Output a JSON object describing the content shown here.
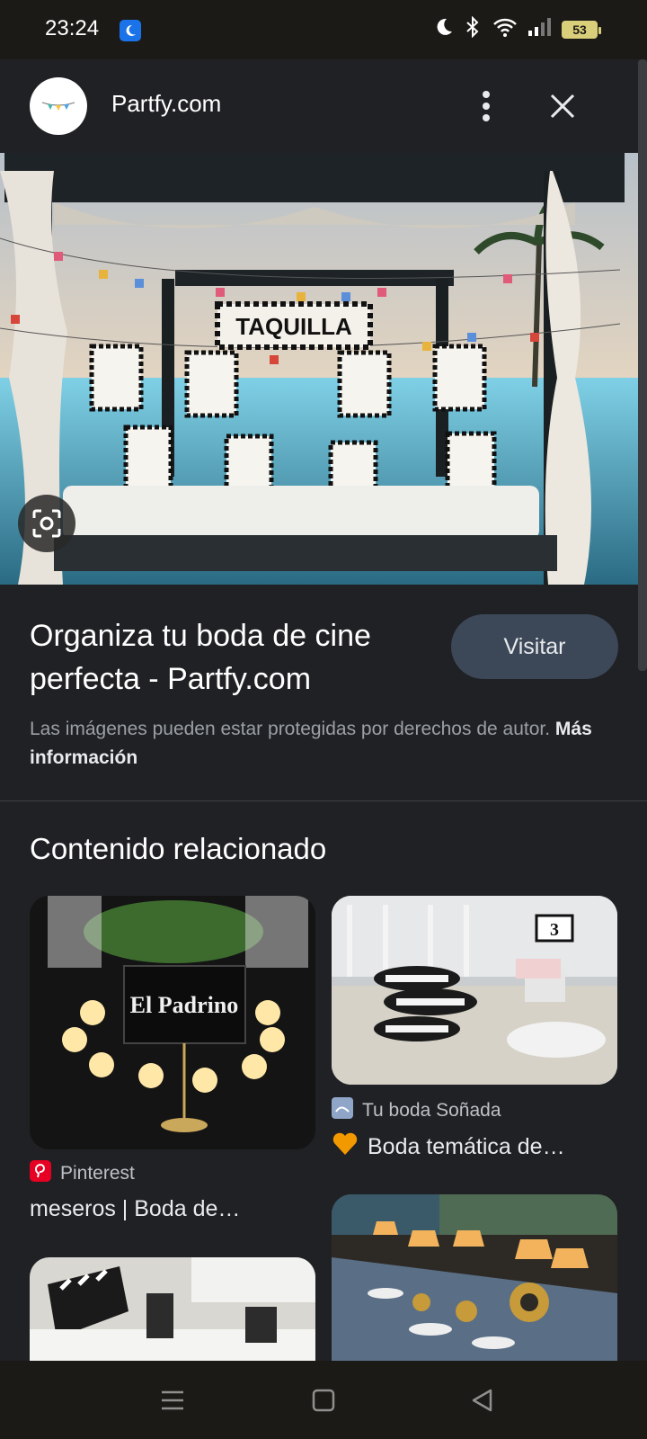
{
  "status_bar": {
    "time": "23:24",
    "battery": "53",
    "icons": [
      "moon-icon",
      "bluetooth-icon",
      "wifi-icon",
      "signal-icon",
      "battery-icon"
    ]
  },
  "header": {
    "site_name": "Partfy.com",
    "icons": [
      "more-vert-icon",
      "close-icon"
    ]
  },
  "hero": {
    "sign_text": "TAQUILLA"
  },
  "result": {
    "title": "Organiza tu boda de cine perfecta - Partfy.com",
    "visit_label": "Visitar",
    "copyright_text": "Las imágenes pueden estar protegidas por derechos de autor.",
    "more_info_label": "Más información"
  },
  "related": {
    "heading": "Contenido relacionado",
    "cards": [
      {
        "source": "Pinterest",
        "title": "meseros | Boda de…",
        "image_text": "El Padrino"
      },
      {
        "source": "Tu boda Soñada",
        "title": "Boda temática de…",
        "image_text": "3"
      }
    ]
  },
  "colors": {
    "background": "#202124",
    "visit_button": "#3c4858",
    "pinterest": "#e60023",
    "heart": "#f29900"
  }
}
